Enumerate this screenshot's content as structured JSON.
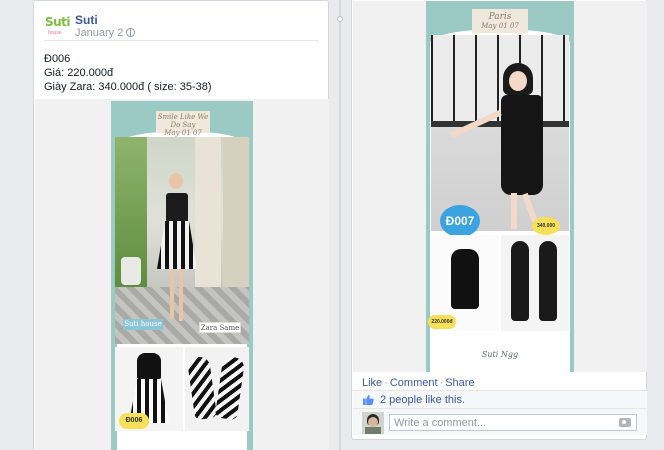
{
  "post_left": {
    "author": "Suti",
    "date": "January 2",
    "logo": {
      "text": "Suti",
      "subtext": "house"
    },
    "lines": [
      "Đ006",
      "Giá: 220.000đ",
      "Giày Zara: 340.000đ ( size: 35-38)"
    ],
    "collage": {
      "tagline_top": "Smile Like We Do Say",
      "tagline_sub": "May 01 07",
      "label_brand": "Suti house",
      "label_shoes": "Zara Same",
      "code_badge": "Đ006"
    }
  },
  "post_right": {
    "collage": {
      "tagline_top": "Paris",
      "tagline_sub": "May 01 07",
      "code_badge": "Đ007",
      "price_dress": "220.000đ",
      "price_shoes": "340.000",
      "footer_sign": "Suti Ngg"
    },
    "actions": {
      "like": "Like",
      "comment": "Comment",
      "share": "Share"
    },
    "likes_text": "2 people like this.",
    "comment_placeholder": "Write a comment..."
  },
  "colors": {
    "link": "#3b5998",
    "accent_teal": "#9bc9c3",
    "badge_blue": "#3aa3e0",
    "badge_yellow": "#f6e05a"
  }
}
